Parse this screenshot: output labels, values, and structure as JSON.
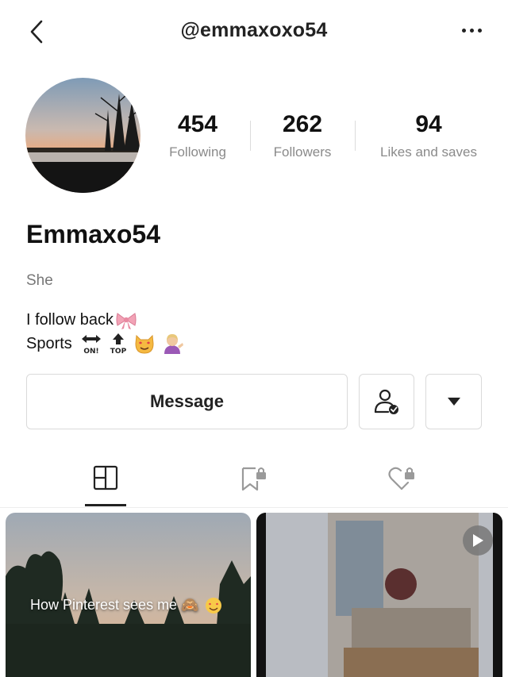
{
  "header": {
    "handle": "@emmaxoxo54",
    "back_icon": "chevron-left-icon",
    "more_icon": "more-horizontal-icon"
  },
  "profile": {
    "avatar_icon": "sunset-avatar",
    "display_name": "Emmaxo54",
    "pronoun": "She",
    "bio_line1": "I follow back",
    "bio_line1_emoji": "ribbon-emoji",
    "bio_line2": "Sports",
    "bio_line2_emojis": [
      "on-arrow-emoji",
      "top-arrow-emoji",
      "heart-eyes-cat-emoji",
      "tipping-hand-emoji"
    ]
  },
  "stats": [
    {
      "value": "454",
      "label": "Following"
    },
    {
      "value": "262",
      "label": "Followers"
    },
    {
      "value": "94",
      "label": "Likes and saves"
    }
  ],
  "actions": {
    "message_label": "Message",
    "follow_icon": "user-check-icon",
    "dropdown_icon": "triangle-down-icon"
  },
  "tabs": [
    {
      "icon": "grid-layout-icon",
      "active": true
    },
    {
      "icon": "bookmark-locked-icon",
      "active": false
    },
    {
      "icon": "heart-locked-icon",
      "active": false
    }
  ],
  "posts": [
    {
      "caption": "How Pinterest sees me",
      "type": "image"
    },
    {
      "caption": "",
      "type": "video",
      "icon": "play-icon"
    }
  ],
  "colors": {
    "text": "#111111",
    "muted": "#8a8a8a",
    "border": "#dadada"
  }
}
